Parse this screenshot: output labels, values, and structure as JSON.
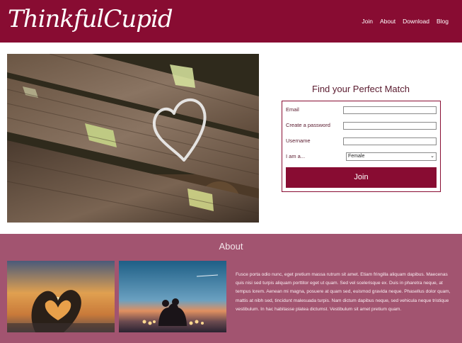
{
  "header": {
    "logo": "ThinkfulCupid",
    "nav": [
      "Join",
      "About",
      "Download",
      "Blog"
    ]
  },
  "signup": {
    "title": "Find your Perfect Match",
    "email_label": "Email",
    "password_label": "Create a password",
    "username_label": "Username",
    "gender_label": "I am a...",
    "gender_selected": "Female",
    "join_label": "Join"
  },
  "about": {
    "title": "About",
    "text": "Fusce porta odio nunc, eget pretium massa rutrum sit amet. Etiam fringilla aliquam dapibus. Maecenas quis nisi sed turpis aliquam porttitor eget ut quam. Sed vel scelerisque ex. Duis in pharetra neque, at tempus lorem. Aenean mi magna, posuere at quam sed, euismod gravida neque. Phasellus dolor quam, mattis at nibh sed, tincidunt malesuada turpis. Nam dictum dapibus neque, sed vehicula neque tristique vestibulum. In hac habitasse platea dictumst. Vestibulum sit amet pretium quam."
  },
  "colors": {
    "brand": "#880c32",
    "about_bg": "#a25470"
  },
  "icons": {
    "select_caret": "chevron-down-icon"
  }
}
